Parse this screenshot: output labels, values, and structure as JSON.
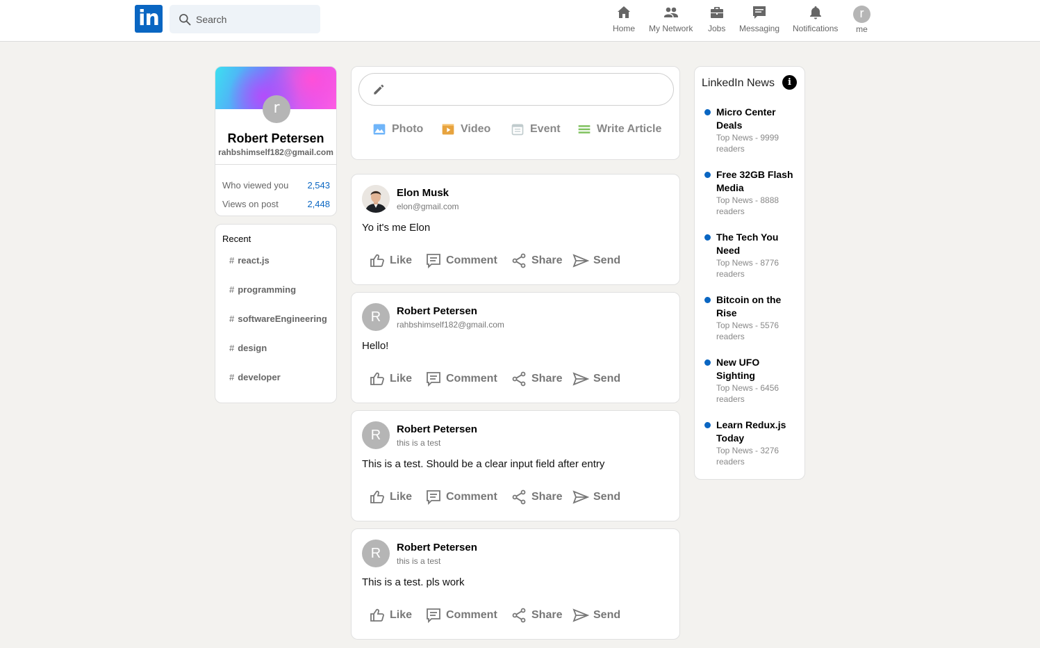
{
  "header": {
    "logo_text": "in",
    "search_placeholder": "Search",
    "nav": [
      {
        "label": "Home",
        "icon": "home-icon"
      },
      {
        "label": "My Network",
        "icon": "network-icon"
      },
      {
        "label": "Jobs",
        "icon": "briefcase-icon"
      },
      {
        "label": "Messaging",
        "icon": "chat-icon"
      },
      {
        "label": "Notifications",
        "icon": "bell-icon"
      },
      {
        "label": "me",
        "icon": "avatar",
        "avatar_letter": "r"
      }
    ]
  },
  "profile": {
    "avatar_letter": "r",
    "name": "Robert Petersen",
    "email": "rahbshimself182@gmail.com",
    "stats": [
      {
        "label": "Who viewed you",
        "value": "2,543"
      },
      {
        "label": "Views on post",
        "value": "2,448"
      }
    ]
  },
  "recent": {
    "title": "Recent",
    "hash": "#",
    "tags": [
      "react.js",
      "programming",
      "softwareEngineering",
      "design",
      "developer"
    ]
  },
  "composer": {
    "options": [
      {
        "label": "Photo",
        "icon": "photo-icon",
        "color": "#70b5f9"
      },
      {
        "label": "Video",
        "icon": "video-icon",
        "color": "#e7a33e"
      },
      {
        "label": "Event",
        "icon": "calendar-icon",
        "color": "#c0cbcd"
      },
      {
        "label": "Write Article",
        "icon": "article-icon",
        "color": "#7fc15e"
      }
    ]
  },
  "posts": [
    {
      "name": "Elon Musk",
      "sub": "elon@gmail.com",
      "message": "Yo it's me Elon",
      "avatar_letter": ""
    },
    {
      "name": "Robert Petersen",
      "sub": "rahbshimself182@gmail.com",
      "message": "Hello!",
      "avatar_letter": "R"
    },
    {
      "name": "Robert Petersen",
      "sub": "this is a test",
      "message": "This is a test. Should be a clear input field after entry",
      "avatar_letter": "R"
    },
    {
      "name": "Robert Petersen",
      "sub": "this is a test",
      "message": "This is a test. pls work",
      "avatar_letter": "R"
    }
  ],
  "post_actions": [
    "Like",
    "Comment",
    "Share",
    "Send"
  ],
  "news": {
    "title": "LinkedIn News",
    "info_glyph": "i",
    "items": [
      {
        "headline": "Micro Center Deals",
        "sub": "Top News - 9999 readers"
      },
      {
        "headline": "Free 32GB Flash Media",
        "sub": "Top News - 8888 readers"
      },
      {
        "headline": "The Tech You Need",
        "sub": "Top News - 8776 readers"
      },
      {
        "headline": "Bitcoin on the Rise",
        "sub": "Top News - 5576 readers"
      },
      {
        "headline": "New UFO Sighting",
        "sub": "Top News - 6456 readers"
      },
      {
        "headline": "Learn Redux.js Today",
        "sub": "Top News - 3276 readers"
      }
    ]
  },
  "colors": {
    "brand": "#0a66c2",
    "background": "#f3f2ef"
  }
}
